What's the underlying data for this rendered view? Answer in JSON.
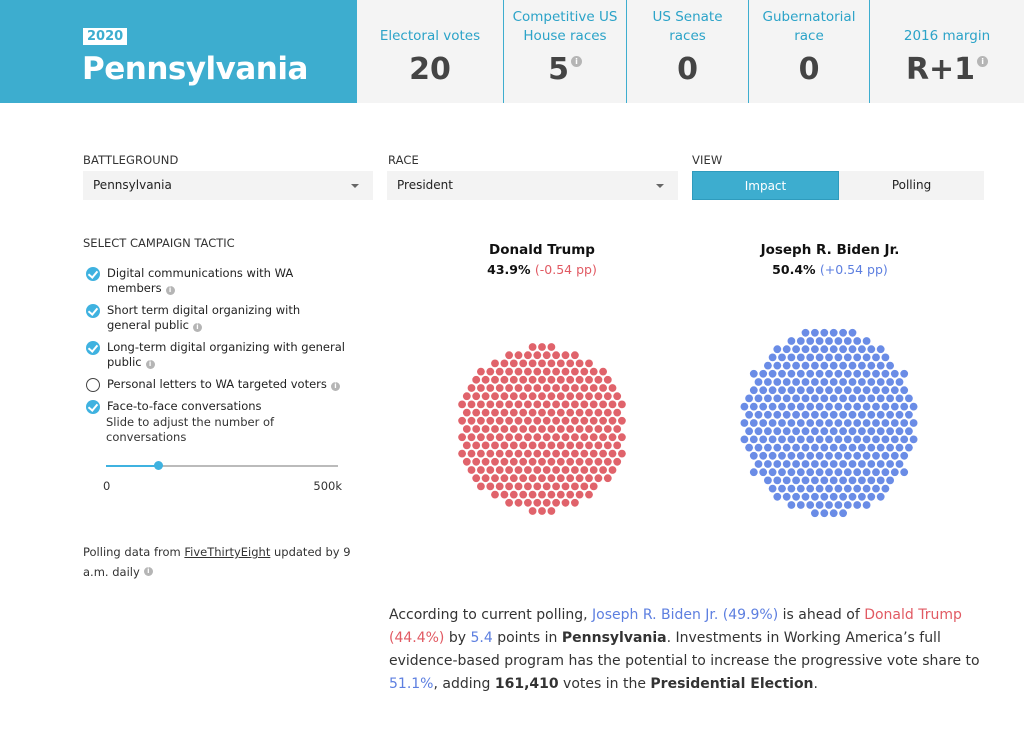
{
  "header": {
    "year": "2020",
    "state": "Pennsylvania",
    "stats": [
      {
        "label": "Electoral votes",
        "value": "20",
        "info": false
      },
      {
        "label": "Competitive US House races",
        "value": "5",
        "info": true
      },
      {
        "label": "US Senate races",
        "value": "0",
        "info": false
      },
      {
        "label": "Gubernatorial race",
        "value": "0",
        "info": false
      },
      {
        "label": "2016 margin",
        "value": "R+1",
        "info": true
      }
    ]
  },
  "controls": {
    "battleground_label": "BATTLEGROUND",
    "battleground_value": "Pennsylvania",
    "race_label": "RACE",
    "race_value": "President",
    "view_label": "VIEW",
    "view_options": [
      "Impact",
      "Polling"
    ],
    "view_selected": "Impact"
  },
  "tactics": {
    "title": "SELECT CAMPAIGN TACTIC",
    "items": [
      {
        "label": "Digital communications with WA members",
        "checked": true,
        "info": true
      },
      {
        "label": "Short term digital organizing with general public",
        "checked": true,
        "info": true
      },
      {
        "label": "Long-term digital organizing with general public",
        "checked": true,
        "info": true
      },
      {
        "label": "Personal letters to WA targeted voters",
        "checked": false,
        "info": true
      },
      {
        "label": "Face-to-face conversations",
        "checked": true,
        "info": false
      }
    ],
    "slider_help": "Slide to adjust the number of conversations",
    "slider_min_label": "0",
    "slider_max_label": "500k",
    "slider_fraction": 0.225
  },
  "polling_note": {
    "prefix": "Polling data from ",
    "link": "FiveThirtyEight",
    "suffix": " updated by 9 a.m. daily"
  },
  "candidates": [
    {
      "name": "Donald Trump",
      "pct": "43.9%",
      "delta": "(-0.54 pp)",
      "color": "#e0636b",
      "dot_count": 290
    },
    {
      "name": "Joseph R. Biden Jr.",
      "pct": "50.4%",
      "delta": "(+0.54 pp)",
      "color": "#6a8ce6",
      "dot_count": 335
    }
  ],
  "summary": {
    "t1": "According to current polling, ",
    "biden": "Joseph R. Biden Jr. (49.9%)",
    "t2": " is ahead of ",
    "trump": "Donald Trump (44.4%)",
    "t3": " by ",
    "margin": "5.4",
    "t4": " points in ",
    "state": "Pennsylvania",
    "t5": ". Investments in Working America’s full evidence-based program has the potential to increase the progressive vote share to ",
    "share": "51.1%",
    "t6": ", adding ",
    "votes": "161,410",
    "t7": " votes in the ",
    "election": "Presidential Election",
    "t8": "."
  },
  "colors": {
    "accent": "#3dadcf",
    "trump_red": "#e15a63",
    "biden_blue": "#5d7fe0"
  }
}
